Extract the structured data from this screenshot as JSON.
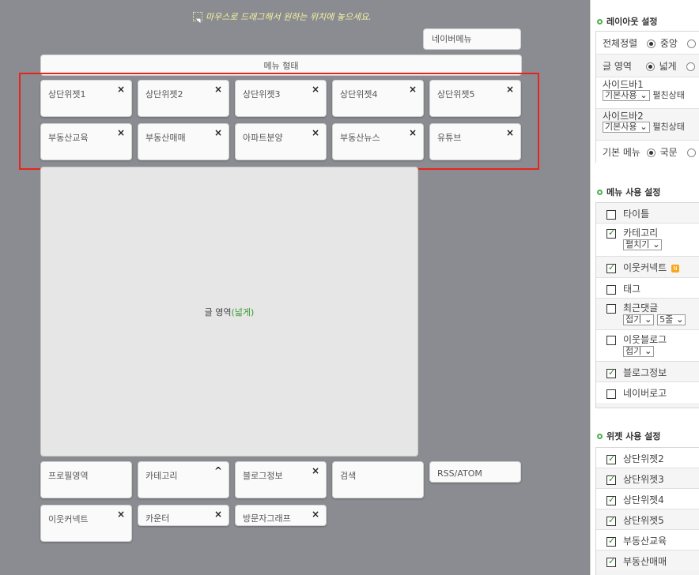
{
  "hint": "마우스로 드래그해서 원하는 위치에 놓으세요.",
  "naver_menu": "네이버메뉴",
  "menu_shape": "메뉴 형태",
  "top_widgets_row1": [
    "상단위젯1",
    "상단위젯2",
    "상단위젯3",
    "상단위젯4",
    "상단위젯5"
  ],
  "top_widgets_row2": [
    "부동산교육",
    "부동산매매",
    "아파트분양",
    "부동산뉴스",
    "유튜브"
  ],
  "content_area": {
    "label": "글 영역",
    "mode": "(넓게)"
  },
  "bottom_widgets_row1": [
    {
      "label": "프로필영역",
      "control": ""
    },
    {
      "label": "카테고리",
      "control": "^"
    },
    {
      "label": "블로그정보",
      "control": "×"
    },
    {
      "label": "검색",
      "control": ""
    },
    {
      "label": "RSS/ATOM",
      "control": ""
    }
  ],
  "bottom_widgets_row2": [
    {
      "label": "이웃커넥트",
      "control": "×"
    },
    {
      "label": "카운터",
      "control": "×"
    },
    {
      "label": "방문자그래프",
      "control": "×"
    }
  ],
  "close_glyph": "×",
  "layout_settings": {
    "title": "레이아웃 설정",
    "align_label": "전체정렬",
    "align_option": "중앙",
    "content_label": "글 영역",
    "content_option": "넓게",
    "sidebar1_label": "사이드바1",
    "sidebar1_select": "기본사용",
    "sidebar1_state": "펼친상태",
    "sidebar2_label": "사이드바2",
    "sidebar2_select": "기본사용",
    "sidebar2_state": "펼친상태",
    "menu_label": "기본 메뉴",
    "menu_option": "국문"
  },
  "menu_settings": {
    "title": "메뉴 사용 설정",
    "items": [
      {
        "label": "타이틀",
        "checked": false
      },
      {
        "label": "카테고리",
        "checked": true,
        "select": "펼치기"
      },
      {
        "label": "이웃커넥트",
        "checked": true,
        "badge": "N"
      },
      {
        "label": "태그",
        "checked": false
      },
      {
        "label": "최근댓글",
        "checked": false,
        "select": "접기",
        "select2": "5줄"
      },
      {
        "label": "이웃블로그",
        "checked": false,
        "select": "접기"
      },
      {
        "label": "블로그정보",
        "checked": true
      },
      {
        "label": "네이버로고",
        "checked": false
      }
    ]
  },
  "widget_settings": {
    "title": "위젯 사용 설정",
    "items": [
      {
        "label": "상단위젯2",
        "checked": true
      },
      {
        "label": "상단위젯3",
        "checked": true
      },
      {
        "label": "상단위젯4",
        "checked": true
      },
      {
        "label": "상단위젯5",
        "checked": true
      },
      {
        "label": "부동산교육",
        "checked": true
      },
      {
        "label": "부동산매매",
        "checked": true
      }
    ]
  },
  "colors": {
    "canvas": "#8a8c91",
    "highlight": "#e8231b",
    "hint": "#f7f3a0",
    "accent_green": "#3a9b2f"
  }
}
